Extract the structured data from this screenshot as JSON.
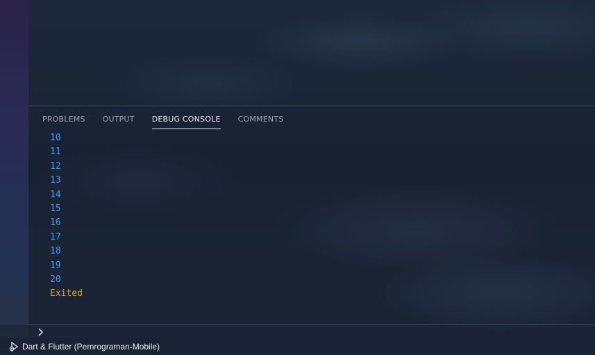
{
  "panel": {
    "tabs": [
      {
        "label": "PROBLEMS",
        "active": false
      },
      {
        "label": "OUTPUT",
        "active": false
      },
      {
        "label": "DEBUG CONSOLE",
        "active": true
      },
      {
        "label": "COMMENTS",
        "active": false
      }
    ],
    "console_lines": [
      "10",
      "11",
      "12",
      "13",
      "14",
      "15",
      "16",
      "17",
      "18",
      "19",
      "20"
    ],
    "exit_message": "Exited",
    "input": {
      "value": "",
      "prompt_icon": "chevron-right-icon"
    }
  },
  "status_bar": {
    "debug_icon": "debug-run-icon",
    "session_label": "Dart & Flutter (Pemrograman-Mobile)"
  },
  "colors": {
    "output_number": "#3d9bf5",
    "exit_message": "#d4a72c",
    "active_tab": "#e8edf3",
    "inactive_tab": "#9aa5b4"
  }
}
